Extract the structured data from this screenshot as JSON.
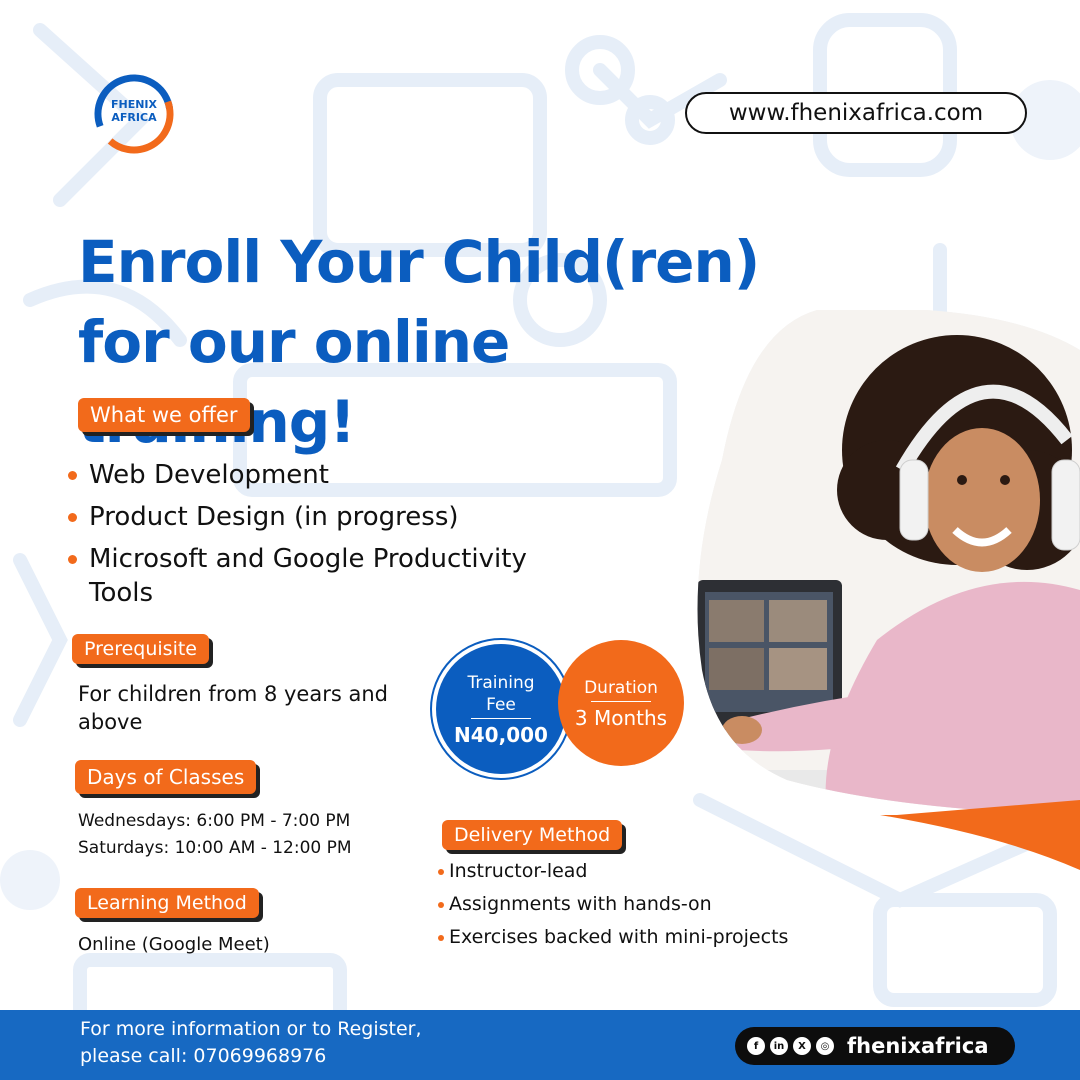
{
  "brand": {
    "logo_text": "FHENIX AFRICA",
    "website": "www.fhenixafrica.com",
    "colors": {
      "blue": "#0b5dbf",
      "orange": "#f26a1b",
      "footer_blue": "#1769c2"
    }
  },
  "headline": {
    "line1": "Enroll Your Child(ren)",
    "line2": "for our online training!"
  },
  "offer": {
    "tag": "What we offer",
    "items": [
      "Web Development",
      "Product Design (in progress)",
      "Microsoft and Google Productivity Tools"
    ]
  },
  "prerequisite": {
    "tag": "Prerequisite",
    "text": "For children from 8 years and above"
  },
  "days": {
    "tag": "Days of Classes",
    "lines": [
      "Wednesdays: 6:00 PM - 7:00 PM",
      "Saturdays: 10:00 AM - 12:00 PM"
    ]
  },
  "learning": {
    "tag": "Learning Method",
    "text": "Online (Google Meet)"
  },
  "fee": {
    "label": "Training Fee",
    "value": "N40,000"
  },
  "duration": {
    "label": "Duration",
    "value": "3 Months"
  },
  "delivery": {
    "tag": "Delivery Method",
    "items": [
      "Instructor-lead",
      "Assignments with hands-on",
      "Exercises backed with mini-projects"
    ]
  },
  "footer": {
    "line1": "For more information or to Register,",
    "line2": "please call: 07069968976",
    "handle": "fhenixafrica",
    "social_icons": [
      "facebook-icon",
      "linkedin-icon",
      "x-icon",
      "instagram-icon"
    ]
  }
}
